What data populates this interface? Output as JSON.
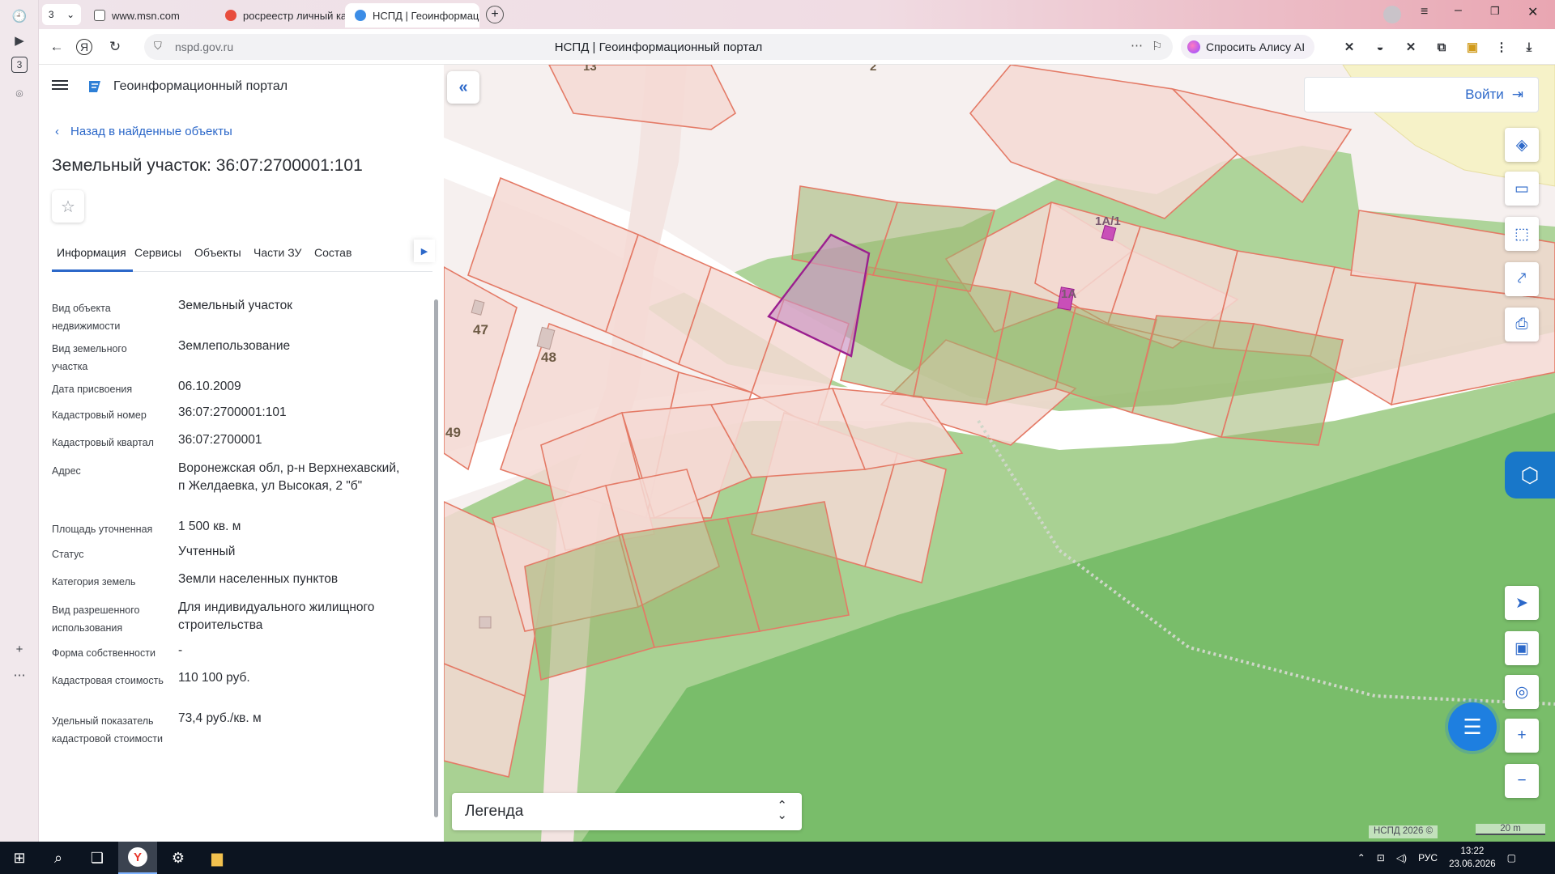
{
  "browser": {
    "tab_count": "3",
    "tabs": [
      {
        "label": "www.msn.com"
      },
      {
        "label": "росреестр личный кабин"
      },
      {
        "label": "НСПД | Геоинформаци"
      }
    ],
    "url": "nspd.gov.ru",
    "page_title": "НСПД | Геоинформационный портал",
    "alice_label": "Спросить Алису AI",
    "left_rail_count": "3"
  },
  "panel": {
    "portal_title": "Геоинформационный портал",
    "back_link": "Назад в найденные объекты",
    "object_title": "Земельный участок: 36:07:2700001:101",
    "tabs": [
      {
        "label": "Информация"
      },
      {
        "label": "Сервисы"
      },
      {
        "label": "Объекты"
      },
      {
        "label": "Части ЗУ"
      },
      {
        "label": "Состав"
      }
    ],
    "rows": [
      {
        "label": "Вид объекта недвижимости",
        "value": "Земельный участок"
      },
      {
        "label": "Вид земельного участка",
        "value": "Землепользование"
      },
      {
        "label": "Дата присвоения",
        "value": "06.10.2009"
      },
      {
        "label": "Кадастровый номер",
        "value": "36:07:2700001:101"
      },
      {
        "label": "Кадастровый квартал",
        "value": "36:07:2700001"
      },
      {
        "label": "Адрес",
        "value": "Воронежская обл, р-н Верхнехавский, п Желдаевка, ул Высокая, 2 \"б\""
      },
      {
        "label": "Площадь уточненная",
        "value": "1 500 кв. м"
      },
      {
        "label": "Статус",
        "value": "Учтенный"
      },
      {
        "label": "Категория земель",
        "value": "Земли населенных пунктов"
      },
      {
        "label": "Вид разрешенного использования",
        "value": "Для индивидуального жилищного строительства"
      },
      {
        "label": "Форма собственности",
        "value": "-"
      },
      {
        "label": "Кадастровая стоимость",
        "value": "110 100 руб."
      },
      {
        "label": "Удельный показатель кадастровой стоимости",
        "value": "73,4 руб./кв. м"
      }
    ]
  },
  "map": {
    "login_label": "Войти",
    "legend_label": "Легенда",
    "attribution": "НСПД 2026 ©",
    "scale_label": "20 m",
    "labels": [
      "13",
      "2",
      "47",
      "48",
      "49",
      "1А/1",
      "1А"
    ],
    "colors": {
      "parcel_fill": "#f4d9d3",
      "parcel_stroke": "#e47a66",
      "forest": "#79bd6a",
      "light_green": "#aed49a",
      "road": "#ffffff",
      "selected": "#9b1f8f"
    }
  },
  "taskbar": {
    "lang": "РУС",
    "time": "13:22",
    "date": "23.06.2026"
  }
}
